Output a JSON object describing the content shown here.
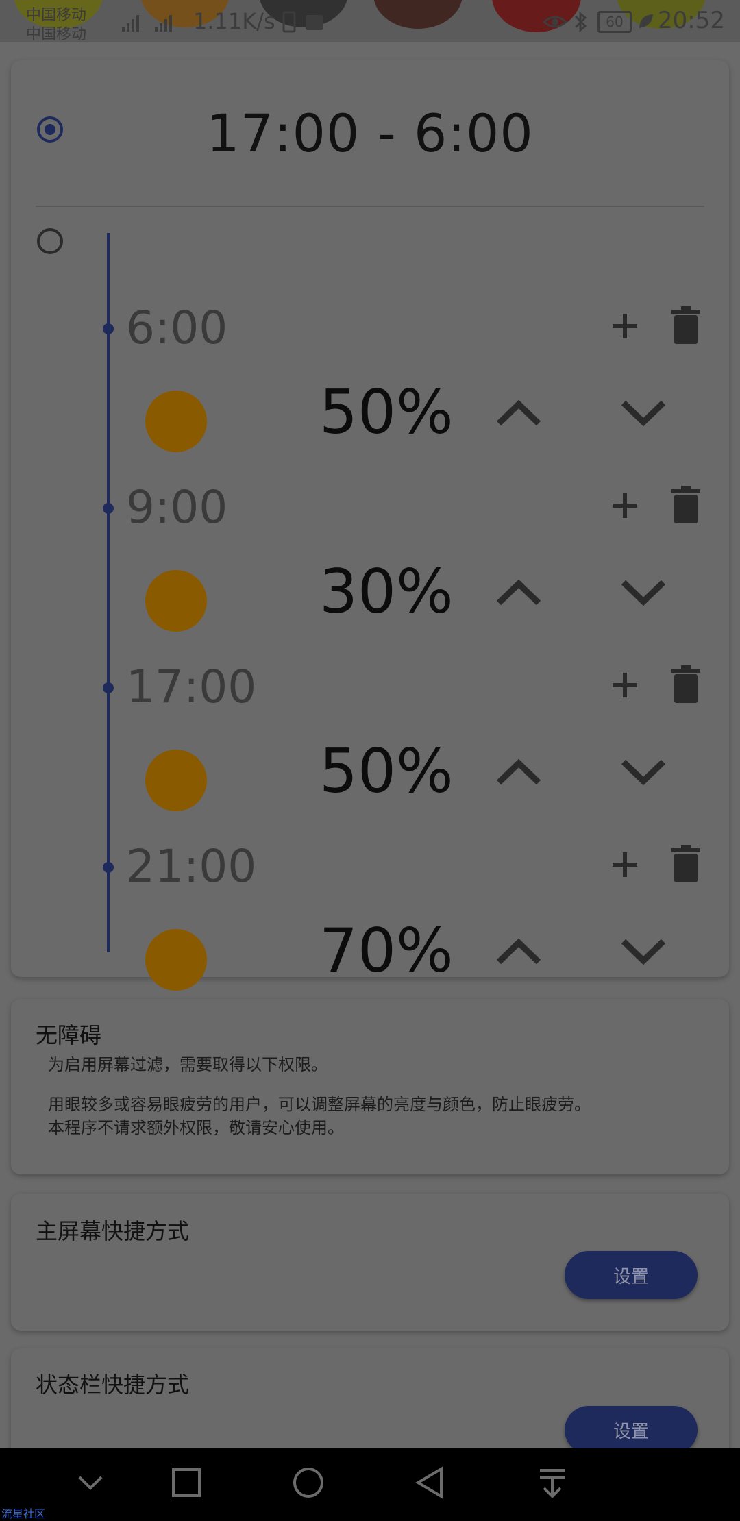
{
  "status_bar": {
    "carrier1": "中国移动",
    "carrier2": "中国移动",
    "net_speed": "1.11K/s",
    "battery": "60",
    "time": "20:52"
  },
  "schedule": {
    "range_title": "17:00  -  6:00",
    "slots": [
      {
        "time": "6:00",
        "percent": "50%"
      },
      {
        "time": "9:00",
        "percent": "30%"
      },
      {
        "time": "17:00",
        "percent": "50%"
      },
      {
        "time": "21:00",
        "percent": "70%"
      }
    ]
  },
  "accessibility": {
    "title": "无障碍",
    "line1": "为启用屏幕过滤，需要取得以下权限。",
    "line2": "用眼较多或容易眼疲劳的用户，可以调整屏幕的亮度与颜色，防止眼疲劳。",
    "line3": "本程序不请求额外权限，敬请安心使用。"
  },
  "home_shortcut": {
    "title": "主屏幕快捷方式",
    "button": "设置"
  },
  "status_shortcut": {
    "title": "状态栏快捷方式",
    "button": "设置"
  },
  "watermark": "流星社区",
  "colors": {
    "accent": "#1f2a5c",
    "swatch": "#8a5a00"
  },
  "icons": {
    "add": "plus-icon",
    "delete": "trash-icon",
    "up": "chevron-up-icon",
    "down": "chevron-down-icon"
  }
}
